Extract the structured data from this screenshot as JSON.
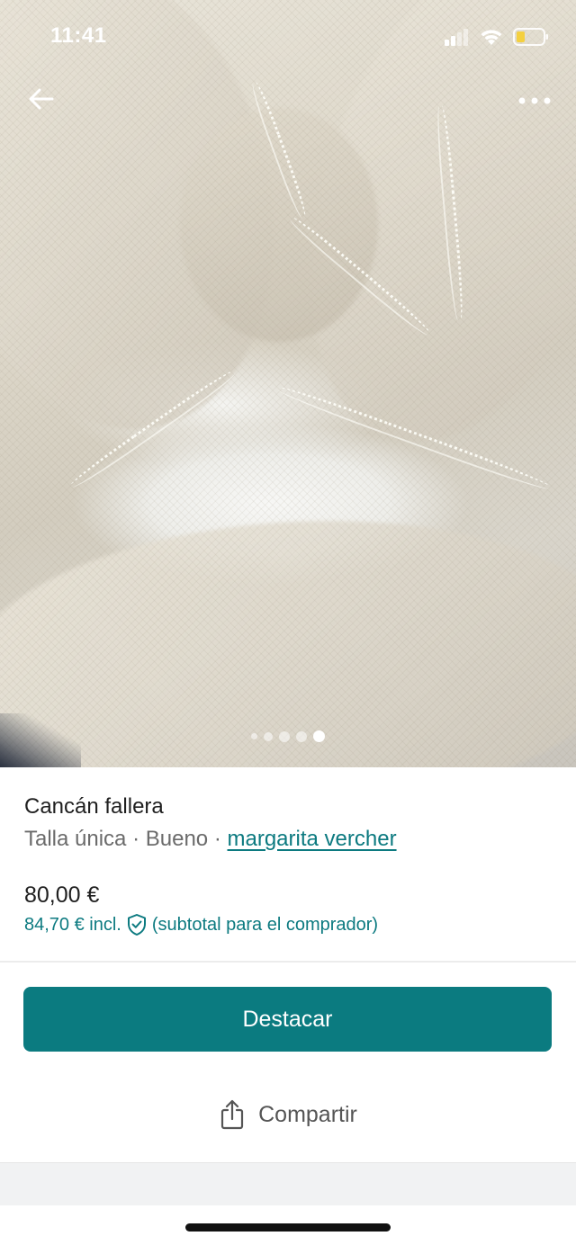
{
  "status_bar": {
    "time": "11:41",
    "icons": [
      "cellular-signal-icon",
      "wifi-icon",
      "battery-icon"
    ],
    "battery_color": "#f4d03f"
  },
  "nav": {
    "back_icon": "arrow-left-icon",
    "more_icon": "more-horizontal-icon"
  },
  "gallery": {
    "image_count": 5,
    "active_index": 4
  },
  "listing": {
    "title": "Cancán fallera",
    "size": "Talla única",
    "condition": "Bueno",
    "separator": "·",
    "seller": "margarita vercher",
    "price": "80,00 €",
    "price_incl": "84,70 € incl.",
    "price_incl_note": "(subtotal para el comprador)"
  },
  "actions": {
    "primary_label": "Destacar",
    "share_label": "Compartir"
  },
  "colors": {
    "accent": "#0b7b80",
    "link": "#0c7a80",
    "muted_text": "#6b6b6b"
  }
}
